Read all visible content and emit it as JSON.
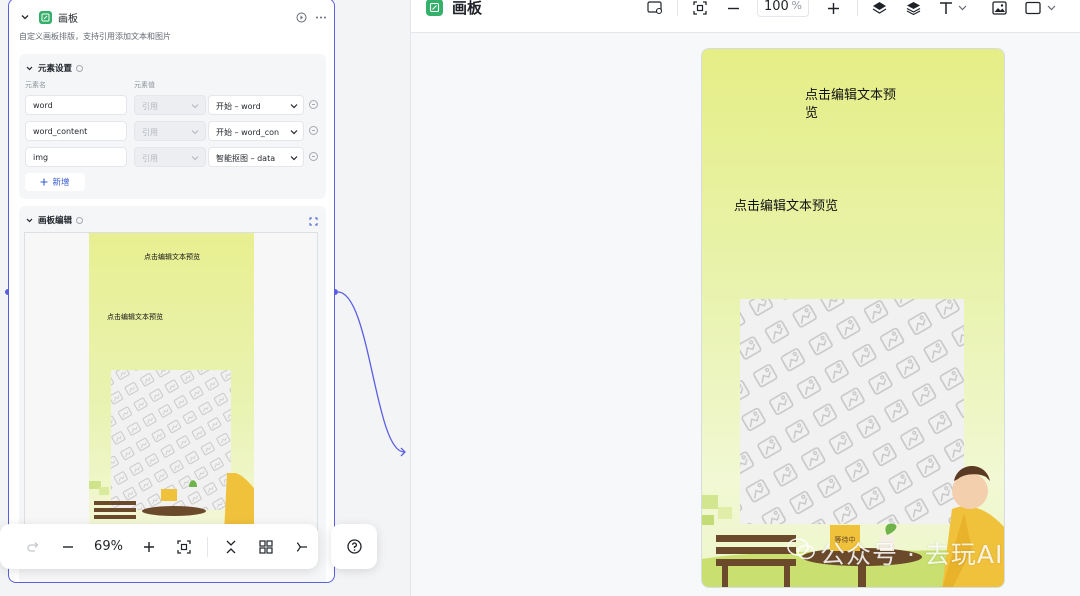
{
  "node": {
    "title": "画板",
    "description": "自定义画板排版，支持引用添加文本和图片"
  },
  "element_settings": {
    "title": "元素设置",
    "col_name": "元素名",
    "col_value": "元素值",
    "rows": [
      {
        "name": "word",
        "mode": "引用",
        "value": "开始 – word"
      },
      {
        "name": "word_content",
        "mode": "引用",
        "value": "开始 – word_con"
      },
      {
        "name": "img",
        "mode": "引用",
        "value": "智能抠图 – data"
      }
    ],
    "add_label": "新增"
  },
  "canvas_edit": {
    "title": "画板编辑",
    "text1": "点击编辑文本预览",
    "text2": "点击编辑文本预览"
  },
  "zoombar": {
    "zoom": "69%"
  },
  "editor": {
    "title": "画板",
    "zoom_value": "100",
    "zoom_unit": "%",
    "poster": {
      "text1": "点击编辑文本预览",
      "text2": "点击编辑文本预览",
      "sign_text": "等待中",
      "watermark": "公众号 · 去玩AI"
    }
  },
  "colors": {
    "accent": "#5b5fe0",
    "node_green": "#35b06a",
    "poster_yellow": "#e5ee86",
    "link_blue": "#3a5ccc"
  }
}
